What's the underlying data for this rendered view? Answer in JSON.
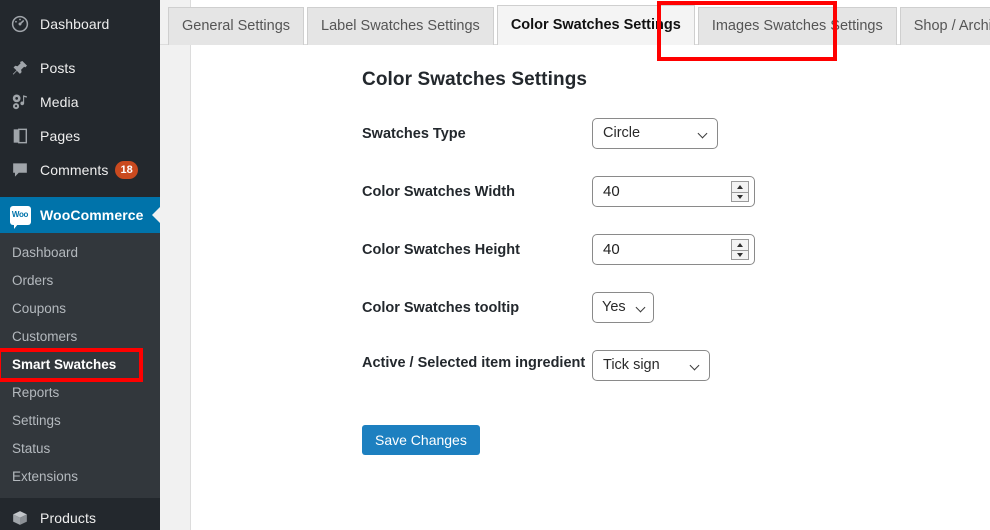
{
  "sidebar": {
    "top_items": [
      {
        "label": "Dashboard",
        "icon": "dashboard-gauge-icon",
        "name": "sidebar-item-dashboard"
      },
      {
        "label": "Posts",
        "icon": "pin-icon",
        "name": "sidebar-item-posts"
      },
      {
        "label": "Media",
        "icon": "media-music-icon",
        "name": "sidebar-item-media"
      },
      {
        "label": "Pages",
        "icon": "pages-book-icon",
        "name": "sidebar-item-pages"
      },
      {
        "label": "Comments",
        "icon": "comment-bubble-icon",
        "name": "sidebar-item-comments",
        "badge": "18"
      }
    ],
    "current_item": {
      "label": "WooCommerce",
      "icon": "woocommerce-icon",
      "name": "sidebar-item-woocommerce",
      "logo_text": "Woo"
    },
    "submenu": [
      {
        "label": "Dashboard",
        "name": "submenu-item-dashboard",
        "active": false
      },
      {
        "label": "Orders",
        "name": "submenu-item-orders",
        "active": false
      },
      {
        "label": "Coupons",
        "name": "submenu-item-coupons",
        "active": false
      },
      {
        "label": "Customers",
        "name": "submenu-item-customers",
        "active": false
      },
      {
        "label": "Smart Swatches",
        "name": "submenu-item-smart-swatches",
        "active": true
      },
      {
        "label": "Reports",
        "name": "submenu-item-reports",
        "active": false
      },
      {
        "label": "Settings",
        "name": "submenu-item-settings",
        "active": false
      },
      {
        "label": "Status",
        "name": "submenu-item-status",
        "active": false
      },
      {
        "label": "Extensions",
        "name": "submenu-item-extensions",
        "active": false
      }
    ],
    "bottom_items": [
      {
        "label": "Products",
        "icon": "product-box-icon",
        "name": "sidebar-item-products"
      }
    ],
    "colors": {
      "background": "#23282d",
      "submenu_background": "#32373c",
      "current_highlight": "#0073aa",
      "badge": "#ca4a1f"
    }
  },
  "tabs": [
    {
      "label": "General Settings",
      "name": "tab-general-settings",
      "active": false
    },
    {
      "label": "Label Swatches Settings",
      "name": "tab-label-swatches-settings",
      "active": false
    },
    {
      "label": "Color Swatches Settings",
      "name": "tab-color-swatches-settings",
      "active": true
    },
    {
      "label": "Images Swatches Settings",
      "name": "tab-images-swatches-settings",
      "active": false
    },
    {
      "label": "Shop / Archive",
      "name": "tab-shop-archive",
      "active": false
    }
  ],
  "main": {
    "heading": "Color Swatches Settings",
    "fields": {
      "swatches_type": {
        "label": "Swatches Type",
        "value": "Circle",
        "options": [
          "Circle"
        ]
      },
      "color_swatches_width": {
        "label": "Color Swatches Width",
        "value": "40"
      },
      "color_swatches_height": {
        "label": "Color Swatches Height",
        "value": "40"
      },
      "color_swatches_tooltip": {
        "label": "Color Swatches tooltip",
        "value": "Yes",
        "options": [
          "Yes"
        ]
      },
      "active_selected_item_ingredient": {
        "label": "Active / Selected item ingredient",
        "value": "Tick sign",
        "options": [
          "Tick sign"
        ]
      }
    },
    "save_label": "Save Changes",
    "colors": {
      "save_button": "#1d80c0",
      "annotation": "#ff0000"
    }
  }
}
